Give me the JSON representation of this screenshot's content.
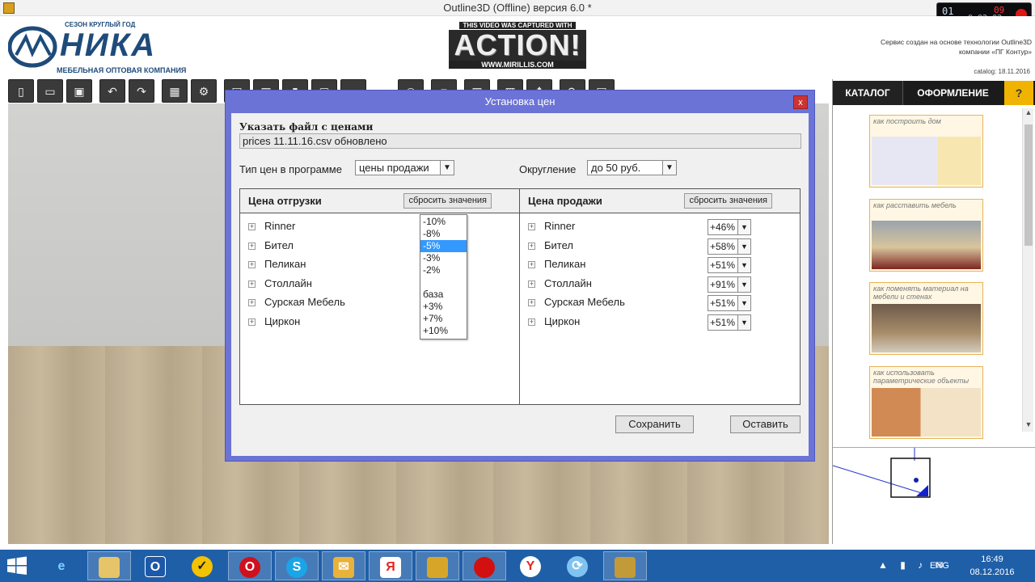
{
  "window": {
    "title": "Outline3D (Offline) версия 6.0 *"
  },
  "recorder": {
    "counter_left": "01",
    "counter_time": "0:02:02",
    "counter_top": "09"
  },
  "brand": {
    "tagline": "СЕЗОН КРУГЛЫЙ ГОД",
    "name": "НИКА",
    "subtitle": "МЕБЕЛЬНАЯ ОПТОВАЯ КОМПАНИЯ",
    "accent": "#1e4b7a"
  },
  "capture_banner": {
    "caption": "THIS VIDEO WAS CAPTURED WITH",
    "name": "ACTION!",
    "url": "WWW.MIRILLIS.COM"
  },
  "service_note": {
    "line1": "Сервис создан на основе технологии Outline3D",
    "line2": "компании «ПГ Контур»"
  },
  "catalog_date": "catalog: 18.11.2016",
  "toolbar": {
    "icons": [
      "new-icon",
      "open-icon",
      "save-icon",
      "undo-icon",
      "redo-icon",
      "walls-icon",
      "settings-icon",
      "wall-tool-icon",
      "room-tool-icon",
      "door-icon",
      "window-tool-icon",
      "dimension-icon",
      "camera-icon",
      "render-icon",
      "view2d-icon",
      "view3d-icon",
      "move-icon",
      "rotate-icon",
      "print-icon"
    ]
  },
  "right_panel": {
    "tabs": [
      "КАТАЛОГ",
      "ОФОРМЛЕНИЕ",
      "?"
    ],
    "cards": [
      {
        "caption": "как построить дом"
      },
      {
        "caption": "как расставить мебель"
      },
      {
        "caption": "как поменять материал на мебели и стенах"
      },
      {
        "caption": "как использовать параметрические объекты"
      }
    ]
  },
  "dialog": {
    "title": "Установка цен",
    "close_label": "x",
    "file_label": "Указать файл с ценами",
    "file_value": "prices 11.11.16.csv обновлено",
    "price_type_label": "Тип цен в программе",
    "price_type_value": "цены продажи",
    "rounding_label": "Округление",
    "rounding_value": "до 50 руб.",
    "shipping_panel": {
      "title": "Цена отгрузки",
      "reset_label": "сбросить значения",
      "rows": [
        "Rinner",
        "Бител",
        "Пеликан",
        "Столлайн",
        "Сурская Мебель",
        "Циркон"
      ],
      "dropdown_options": [
        "-10%",
        "-8%",
        "-5%",
        "-3%",
        "-2%",
        "",
        "база",
        "+3%",
        "+7%",
        "+10%"
      ],
      "dropdown_selected": "-5%"
    },
    "sale_panel": {
      "title": "Цена продажи",
      "reset_label": "сбросить значения",
      "rows": [
        {
          "name": "Rinner",
          "value": "+46%"
        },
        {
          "name": "Бител",
          "value": "+58%"
        },
        {
          "name": "Пеликан",
          "value": "+51%"
        },
        {
          "name": "Столлайн",
          "value": "+91%"
        },
        {
          "name": "Сурская Мебель",
          "value": "+51%"
        },
        {
          "name": "Циркон",
          "value": "+51%"
        }
      ]
    },
    "save_label": "Сохранить",
    "cancel_label": "Оставить"
  },
  "taskbar": {
    "apps": [
      "ie-icon",
      "file-explorer-icon",
      "outlook-icon",
      "norton-icon",
      "opera-icon",
      "skype-icon",
      "mail-icon",
      "yandex-browser-icon",
      "archive-icon",
      "record-icon",
      "yandex-icon",
      "network-icon",
      "outline3d-icon"
    ],
    "lang": "ENG",
    "time": "16:49",
    "date": "08.12.2016"
  }
}
